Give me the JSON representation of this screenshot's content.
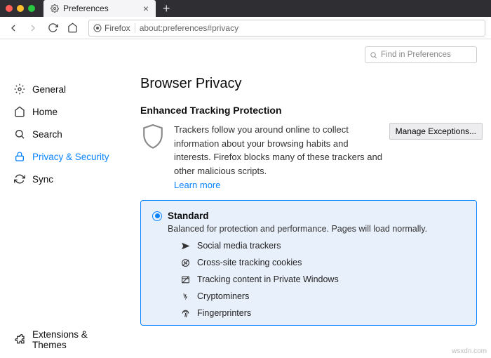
{
  "window": {
    "tab_title": "Preferences",
    "url": "about:preferences#privacy",
    "identity_label": "Firefox"
  },
  "search": {
    "placeholder": "Find in Preferences"
  },
  "sidebar": {
    "items": [
      {
        "label": "General"
      },
      {
        "label": "Home"
      },
      {
        "label": "Search"
      },
      {
        "label": "Privacy & Security"
      },
      {
        "label": "Sync"
      }
    ],
    "bottom": {
      "label": "Extensions & Themes"
    }
  },
  "main": {
    "heading": "Browser Privacy",
    "section_title": "Enhanced Tracking Protection",
    "tracking_text": "Trackers follow you around online to collect information about your browsing habits and interests. Firefox blocks many of these trackers and other malicious scripts.",
    "learn_more": "Learn more",
    "manage_exceptions": "Manage Exceptions...",
    "card": {
      "title": "Standard",
      "subtitle": "Balanced for protection and performance. Pages will load normally.",
      "features": [
        "Social media trackers",
        "Cross-site tracking cookies",
        "Tracking content in Private Windows",
        "Cryptominers",
        "Fingerprinters"
      ]
    }
  },
  "watermark": "wsxdn.com"
}
